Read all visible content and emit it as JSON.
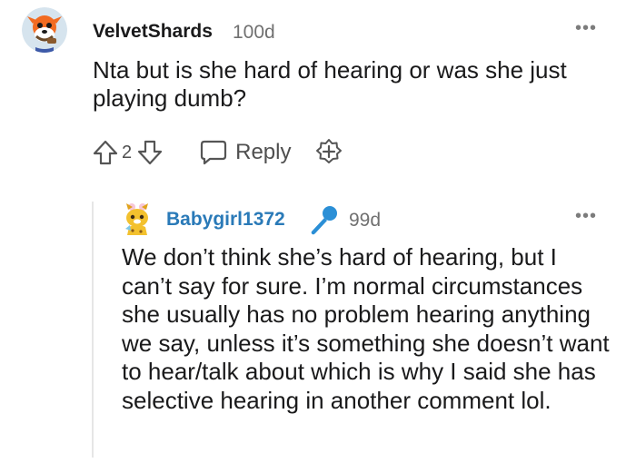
{
  "comment": {
    "username": "VelvetShards",
    "age": "100d",
    "body": "Nta but is she hard of hearing or was she just playing dumb?",
    "vote_count": "2",
    "reply_label": "Reply",
    "more_label": "•••",
    "icons": {
      "avatar": "snoo-avatar",
      "upvote": "upvote-arrow-icon",
      "downvote": "downvote-arrow-icon",
      "reply": "speech-bubble-icon",
      "award": "add-award-icon"
    }
  },
  "reply": {
    "username": "Babygirl1372",
    "age": "99d",
    "more_label": "•••",
    "body": "We don’t think she’s hard of hearing, but I can’t say for sure. I’m normal circumstances she usually has no problem hearing anything we say, unless it’s something she doesn’t want to hear/talk about which is why I said she has selective hearing in another comment lol.",
    "icons": {
      "avatar": "cartoon-animal-avatar",
      "flair": "microphone-icon"
    }
  },
  "colors": {
    "username_reply": "#2a7ab8",
    "mic_accent": "#2b8fd6",
    "muted_text": "#707070",
    "thread_line": "#e6e6e6"
  }
}
